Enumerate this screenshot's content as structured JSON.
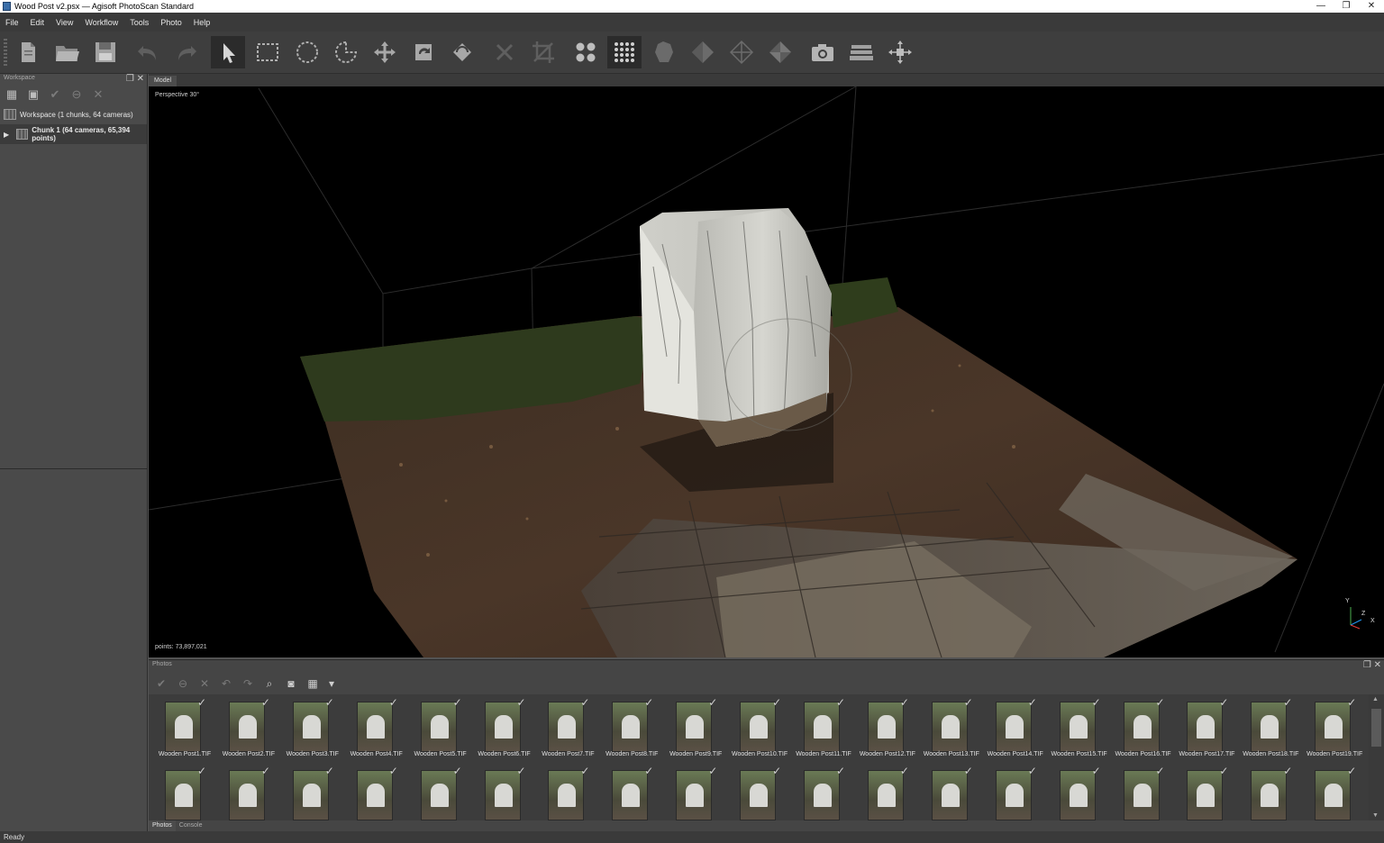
{
  "window": {
    "title": "Wood Post v2.psx — Agisoft PhotoScan Standard",
    "controls": [
      "—",
      "❐",
      "✕"
    ]
  },
  "menu": [
    "File",
    "Edit",
    "View",
    "Workflow",
    "Tools",
    "Photo",
    "Help"
  ],
  "toolbar": {
    "icons": [
      "new-icon",
      "open-icon",
      "save-icon",
      "undo-icon",
      "redo-icon",
      "navigation-icon",
      "rectangle-selection-icon",
      "circle-selection-icon",
      "free-form-selection-icon",
      "move-region-icon",
      "rotate-region-icon",
      "resize-region-icon",
      "delete-selection-icon",
      "crop-selection-icon",
      "point-cloud-icon",
      "dense-cloud-icon",
      "shaded-model-icon",
      "solid-model-icon",
      "wireframe-model-icon",
      "textured-model-icon",
      "show-cameras-icon",
      "show-layers-icon",
      "reset-view-icon"
    ],
    "active": [
      "navigation-icon",
      "dense-cloud-icon"
    ]
  },
  "workspace": {
    "title": "Workspace",
    "root_label": "Workspace (1 chunks, 64 cameras)",
    "chunk_label": "Chunk 1 (64 cameras, 65,394 points)"
  },
  "model": {
    "tab": "Model",
    "view_label": "Perspective 30°",
    "points_label": "points: 73,897,021",
    "axis": {
      "y": "Y",
      "z": "Z",
      "x": "X"
    }
  },
  "photos": {
    "title": "Photos",
    "row1": [
      "Wooden Post1.TIF",
      "Wooden Post2.TIF",
      "Wooden Post3.TIF",
      "Wooden Post4.TIF",
      "Wooden Post5.TIF",
      "Wooden Post6.TIF",
      "Wooden Post7.TIF",
      "Wooden Post8.TIF",
      "Wooden Post9.TIF",
      "Wooden Post10.TIF",
      "Wooden Post11.TIF",
      "Wooden Post12.TIF",
      "Wooden Post13.TIF",
      "Wooden Post14.TIF",
      "Wooden Post15.TIF",
      "Wooden Post16.TIF",
      "Wooden Post17.TIF",
      "Wooden Post18.TIF",
      "Wooden Post19.TIF"
    ],
    "row2_count": 19,
    "check": "✓",
    "tabs": [
      "Photos",
      "Console"
    ]
  },
  "status": "Ready"
}
